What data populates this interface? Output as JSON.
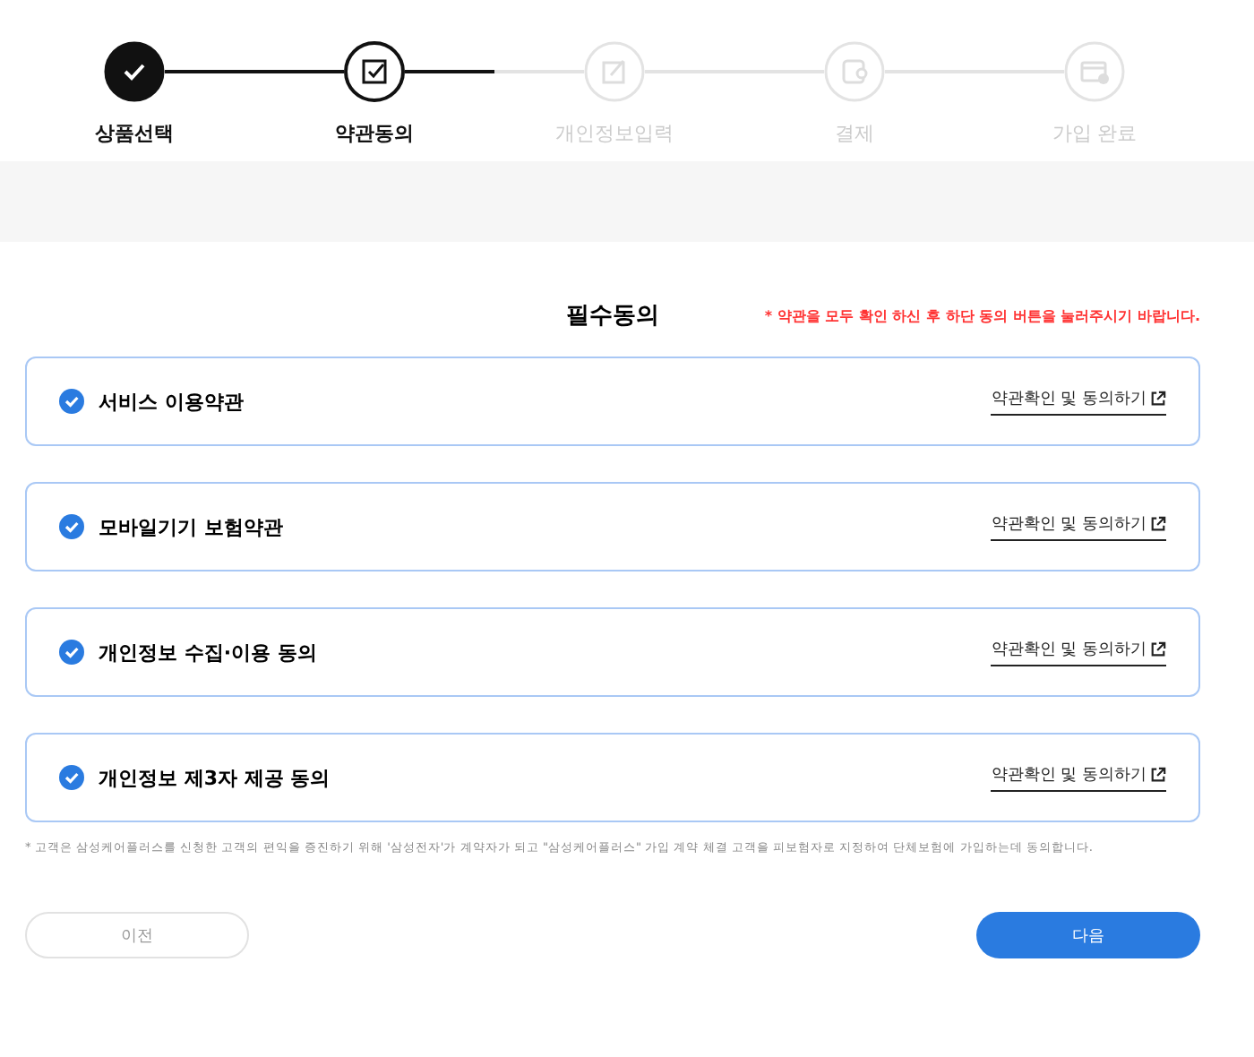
{
  "steps": [
    {
      "label": "상품선택",
      "completed": true,
      "selected": false
    },
    {
      "label": "약관동의",
      "completed": false,
      "selected": true
    },
    {
      "label": "개인정보입력",
      "completed": false,
      "selected": false
    },
    {
      "label": "결제",
      "completed": false,
      "selected": false
    },
    {
      "label": "가입 완료",
      "completed": false,
      "selected": false
    }
  ],
  "section": {
    "title": "필수동의",
    "notice": "* 약관을 모두 확인 하신 후 하단 동의 버튼을 눌러주시기 바랍니다."
  },
  "agreements": [
    {
      "label": "서비스 이용약관",
      "checked": true,
      "link": "약관확인 및 동의하기"
    },
    {
      "label": "모바일기기 보험약관",
      "checked": true,
      "link": "약관확인 및 동의하기"
    },
    {
      "label": "개인정보 수집·이용 동의",
      "checked": true,
      "link": "약관확인 및 동의하기"
    },
    {
      "label": "개인정보 제3자 제공 동의",
      "checked": true,
      "link": "약관확인 및 동의하기"
    }
  ],
  "footnote": "* 고객은 삼성케어플러스를 신청한 고객의 편익을 증진하기 위해 '삼성전자'가 계약자가 되고 \"삼성케어플러스\" 가입 계약 체결 고객을 피보험자로 지정하여 단체보험에 가입하는데 동의합니다.",
  "buttons": {
    "prev": "이전",
    "next": "다음"
  }
}
